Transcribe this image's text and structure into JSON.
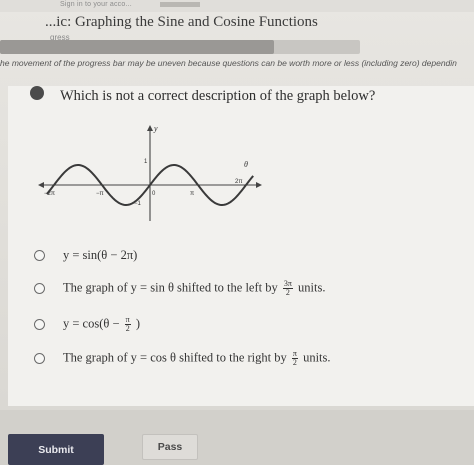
{
  "header": {
    "signin_text": "Sign in to your acco...",
    "lesson_title": "...ic: Graphing the Sine and Cosine Functions"
  },
  "progress": {
    "label": "gress",
    "fraction": 0.76,
    "note": "he movement of the progress bar may be uneven because questions can be worth more or less (including zero) dependin"
  },
  "question": {
    "text": "Which is not a correct description of the graph below?",
    "graph": {
      "y_label": "y",
      "theta_label": "θ",
      "tick_labels": [
        "1",
        "−1",
        "−2π",
        "−π",
        "0",
        "π",
        "2π"
      ]
    }
  },
  "choices": [
    {
      "prefix": "y = sin(θ − 2π)",
      "mid": "",
      "frac_num": "",
      "frac_den": "",
      "suffix": ""
    },
    {
      "prefix": "The graph of y = sin θ shifted to the left by",
      "mid": "",
      "frac_num": "3π",
      "frac_den": "2",
      "suffix": " units."
    },
    {
      "prefix": "y = cos(θ −",
      "mid": "",
      "frac_num": "π",
      "frac_den": "2",
      "suffix": ")"
    },
    {
      "prefix": "The graph of y = cos θ shifted to the right by",
      "mid": "",
      "frac_num": "π",
      "frac_den": "2",
      "suffix": " units."
    }
  ],
  "footer": {
    "submit_label": "Submit",
    "pass_label": "Pass"
  },
  "colors": {
    "submit_bg": "#3c3f55",
    "curve": "#3a3a3a"
  }
}
